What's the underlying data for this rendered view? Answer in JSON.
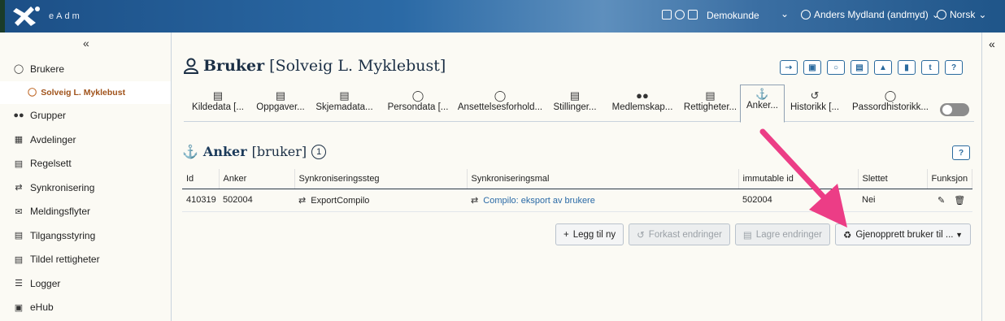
{
  "topbar": {
    "brand": "eAdm",
    "customer": "Demokunde",
    "user": "Anders Mydland (andmyd)",
    "language": "Norsk"
  },
  "sidebar": {
    "collapse": "«",
    "items": [
      {
        "label": "Brukere",
        "icon": "user-icon"
      },
      {
        "label": "Grupper",
        "icon": "group-icon"
      },
      {
        "label": "Avdelinger",
        "icon": "org-chart-icon"
      },
      {
        "label": "Regelsett",
        "icon": "rules-icon"
      },
      {
        "label": "Synkronisering",
        "icon": "sync-icon"
      },
      {
        "label": "Meldingsflyter",
        "icon": "message-flow-icon"
      },
      {
        "label": "Tilgangsstyring",
        "icon": "access-icon"
      },
      {
        "label": "Tildel rettigheter",
        "icon": "assign-rights-icon"
      },
      {
        "label": "Logger",
        "icon": "log-icon"
      },
      {
        "label": "eHub",
        "icon": "puzzle-icon"
      }
    ],
    "sub_item": "Solveig L. Myklebust"
  },
  "right_collapse": "«",
  "page": {
    "title_bold": "Bruker",
    "title_sub": "[Solveig L. Myklebust]",
    "title_actions": [
      "login-icon",
      "lock-icon",
      "chat-icon",
      "id-card-icon",
      "pin-icon",
      "bookmark-icon",
      "t-icon",
      "?"
    ]
  },
  "tabs": [
    {
      "label": "Kildedata [..."
    },
    {
      "label": "Oppgaver..."
    },
    {
      "label": "Skjemadata..."
    },
    {
      "label": "Persondata [..."
    },
    {
      "label": "Ansettelsesforhold..."
    },
    {
      "label": "Stillinger..."
    },
    {
      "label": "Medlemskap..."
    },
    {
      "label": "Rettigheter..."
    },
    {
      "label": "Anker..."
    },
    {
      "label": "Historikk [..."
    },
    {
      "label": "Passordhistorikk..."
    }
  ],
  "section": {
    "title_bold": "Anker",
    "title_sub": "[bruker]",
    "count": "1",
    "help": "?"
  },
  "table": {
    "headers": [
      "Id",
      "Anker",
      "Synkroniseringssteg",
      "Synkroniseringsmal",
      "immutable id",
      "Slettet",
      "Funksjon"
    ],
    "rows": [
      {
        "id": "410319",
        "anker": "502004",
        "steg": "ExportCompilo",
        "mal": "Compilo: eksport av brukere",
        "immutable": "502004",
        "slettet": "Nei"
      }
    ]
  },
  "actions": {
    "add": "Legg til ny",
    "discard": "Forkast endringer",
    "save": "Lagre endringer",
    "restore": "Gjenopprett bruker til ..."
  },
  "colors": {
    "accent": "#2a6a9e",
    "arrow": "#ec3d86",
    "sub_item": "#a0531b"
  }
}
